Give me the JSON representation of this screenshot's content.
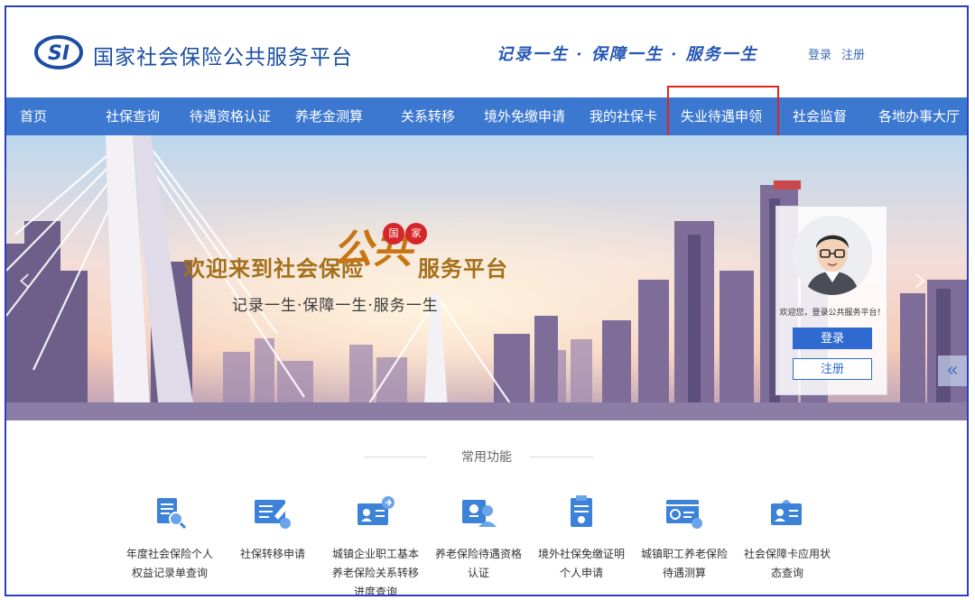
{
  "header": {
    "site_title": "国家社会保险公共服务平台",
    "logo_text": "SI",
    "slogan": "记录一生 · 保障一生 · 服务一生",
    "login": "登录",
    "register": "注册"
  },
  "nav": {
    "items": [
      "首页",
      "社保查询",
      "待遇资格认证",
      "养老金测算",
      "关系转移",
      "境外免缴申请",
      "我的社保卡",
      "失业待遇申领",
      "社会监督",
      "各地办事大厅"
    ]
  },
  "banner": {
    "welcome_pre": "欢迎来到社会保险",
    "welcome_calli": "公共",
    "welcome_badge_1": "国",
    "welcome_badge_2": "家",
    "welcome_post": "服务平台",
    "subtitle": "记录一生·保障一生·服务一生",
    "prev": "‹",
    "next": "›",
    "side_tab": "«"
  },
  "login_panel": {
    "greeting": "欢迎您，登录公共服务平台！",
    "login_button": "登录",
    "register_button": "注册"
  },
  "common": {
    "title": "常用功能",
    "items": [
      {
        "label": "年度社会保险个人权益记录单查询",
        "icon": "document-search-icon"
      },
      {
        "label": "社保转移申请",
        "icon": "transfer-form-icon"
      },
      {
        "label": "城镇企业职工基本养老保险关系转移进度查询",
        "icon": "id-card-transfer-icon"
      },
      {
        "label": "养老保险待遇资格认证",
        "icon": "certification-user-icon"
      },
      {
        "label": "境外社保免缴证明个人申请",
        "icon": "clipboard-icon"
      },
      {
        "label": "城镇职工养老保险待遇测算",
        "icon": "calculator-card-icon"
      },
      {
        "label": "社会保障卡应用状态查询",
        "icon": "social-card-icon"
      }
    ]
  },
  "colors": {
    "nav_bg": "#3c78d0",
    "brand_blue": "#1b4ea3",
    "highlight": "#e5231d",
    "icon_blue": "#3b82d8"
  }
}
